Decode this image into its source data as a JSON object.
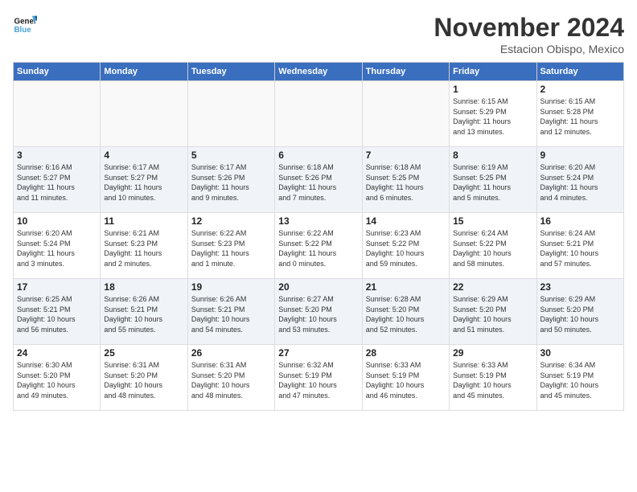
{
  "header": {
    "logo_line1": "General",
    "logo_line2": "Blue",
    "month_title": "November 2024",
    "subtitle": "Estacion Obispo, Mexico"
  },
  "weekdays": [
    "Sunday",
    "Monday",
    "Tuesday",
    "Wednesday",
    "Thursday",
    "Friday",
    "Saturday"
  ],
  "weeks": [
    [
      {
        "day": "",
        "info": ""
      },
      {
        "day": "",
        "info": ""
      },
      {
        "day": "",
        "info": ""
      },
      {
        "day": "",
        "info": ""
      },
      {
        "day": "",
        "info": ""
      },
      {
        "day": "1",
        "info": "Sunrise: 6:15 AM\nSunset: 5:29 PM\nDaylight: 11 hours\nand 13 minutes."
      },
      {
        "day": "2",
        "info": "Sunrise: 6:15 AM\nSunset: 5:28 PM\nDaylight: 11 hours\nand 12 minutes."
      }
    ],
    [
      {
        "day": "3",
        "info": "Sunrise: 6:16 AM\nSunset: 5:27 PM\nDaylight: 11 hours\nand 11 minutes."
      },
      {
        "day": "4",
        "info": "Sunrise: 6:17 AM\nSunset: 5:27 PM\nDaylight: 11 hours\nand 10 minutes."
      },
      {
        "day": "5",
        "info": "Sunrise: 6:17 AM\nSunset: 5:26 PM\nDaylight: 11 hours\nand 9 minutes."
      },
      {
        "day": "6",
        "info": "Sunrise: 6:18 AM\nSunset: 5:26 PM\nDaylight: 11 hours\nand 7 minutes."
      },
      {
        "day": "7",
        "info": "Sunrise: 6:18 AM\nSunset: 5:25 PM\nDaylight: 11 hours\nand 6 minutes."
      },
      {
        "day": "8",
        "info": "Sunrise: 6:19 AM\nSunset: 5:25 PM\nDaylight: 11 hours\nand 5 minutes."
      },
      {
        "day": "9",
        "info": "Sunrise: 6:20 AM\nSunset: 5:24 PM\nDaylight: 11 hours\nand 4 minutes."
      }
    ],
    [
      {
        "day": "10",
        "info": "Sunrise: 6:20 AM\nSunset: 5:24 PM\nDaylight: 11 hours\nand 3 minutes."
      },
      {
        "day": "11",
        "info": "Sunrise: 6:21 AM\nSunset: 5:23 PM\nDaylight: 11 hours\nand 2 minutes."
      },
      {
        "day": "12",
        "info": "Sunrise: 6:22 AM\nSunset: 5:23 PM\nDaylight: 11 hours\nand 1 minute."
      },
      {
        "day": "13",
        "info": "Sunrise: 6:22 AM\nSunset: 5:22 PM\nDaylight: 11 hours\nand 0 minutes."
      },
      {
        "day": "14",
        "info": "Sunrise: 6:23 AM\nSunset: 5:22 PM\nDaylight: 10 hours\nand 59 minutes."
      },
      {
        "day": "15",
        "info": "Sunrise: 6:24 AM\nSunset: 5:22 PM\nDaylight: 10 hours\nand 58 minutes."
      },
      {
        "day": "16",
        "info": "Sunrise: 6:24 AM\nSunset: 5:21 PM\nDaylight: 10 hours\nand 57 minutes."
      }
    ],
    [
      {
        "day": "17",
        "info": "Sunrise: 6:25 AM\nSunset: 5:21 PM\nDaylight: 10 hours\nand 56 minutes."
      },
      {
        "day": "18",
        "info": "Sunrise: 6:26 AM\nSunset: 5:21 PM\nDaylight: 10 hours\nand 55 minutes."
      },
      {
        "day": "19",
        "info": "Sunrise: 6:26 AM\nSunset: 5:21 PM\nDaylight: 10 hours\nand 54 minutes."
      },
      {
        "day": "20",
        "info": "Sunrise: 6:27 AM\nSunset: 5:20 PM\nDaylight: 10 hours\nand 53 minutes."
      },
      {
        "day": "21",
        "info": "Sunrise: 6:28 AM\nSunset: 5:20 PM\nDaylight: 10 hours\nand 52 minutes."
      },
      {
        "day": "22",
        "info": "Sunrise: 6:29 AM\nSunset: 5:20 PM\nDaylight: 10 hours\nand 51 minutes."
      },
      {
        "day": "23",
        "info": "Sunrise: 6:29 AM\nSunset: 5:20 PM\nDaylight: 10 hours\nand 50 minutes."
      }
    ],
    [
      {
        "day": "24",
        "info": "Sunrise: 6:30 AM\nSunset: 5:20 PM\nDaylight: 10 hours\nand 49 minutes."
      },
      {
        "day": "25",
        "info": "Sunrise: 6:31 AM\nSunset: 5:20 PM\nDaylight: 10 hours\nand 48 minutes."
      },
      {
        "day": "26",
        "info": "Sunrise: 6:31 AM\nSunset: 5:20 PM\nDaylight: 10 hours\nand 48 minutes."
      },
      {
        "day": "27",
        "info": "Sunrise: 6:32 AM\nSunset: 5:19 PM\nDaylight: 10 hours\nand 47 minutes."
      },
      {
        "day": "28",
        "info": "Sunrise: 6:33 AM\nSunset: 5:19 PM\nDaylight: 10 hours\nand 46 minutes."
      },
      {
        "day": "29",
        "info": "Sunrise: 6:33 AM\nSunset: 5:19 PM\nDaylight: 10 hours\nand 45 minutes."
      },
      {
        "day": "30",
        "info": "Sunrise: 6:34 AM\nSunset: 5:19 PM\nDaylight: 10 hours\nand 45 minutes."
      }
    ]
  ]
}
